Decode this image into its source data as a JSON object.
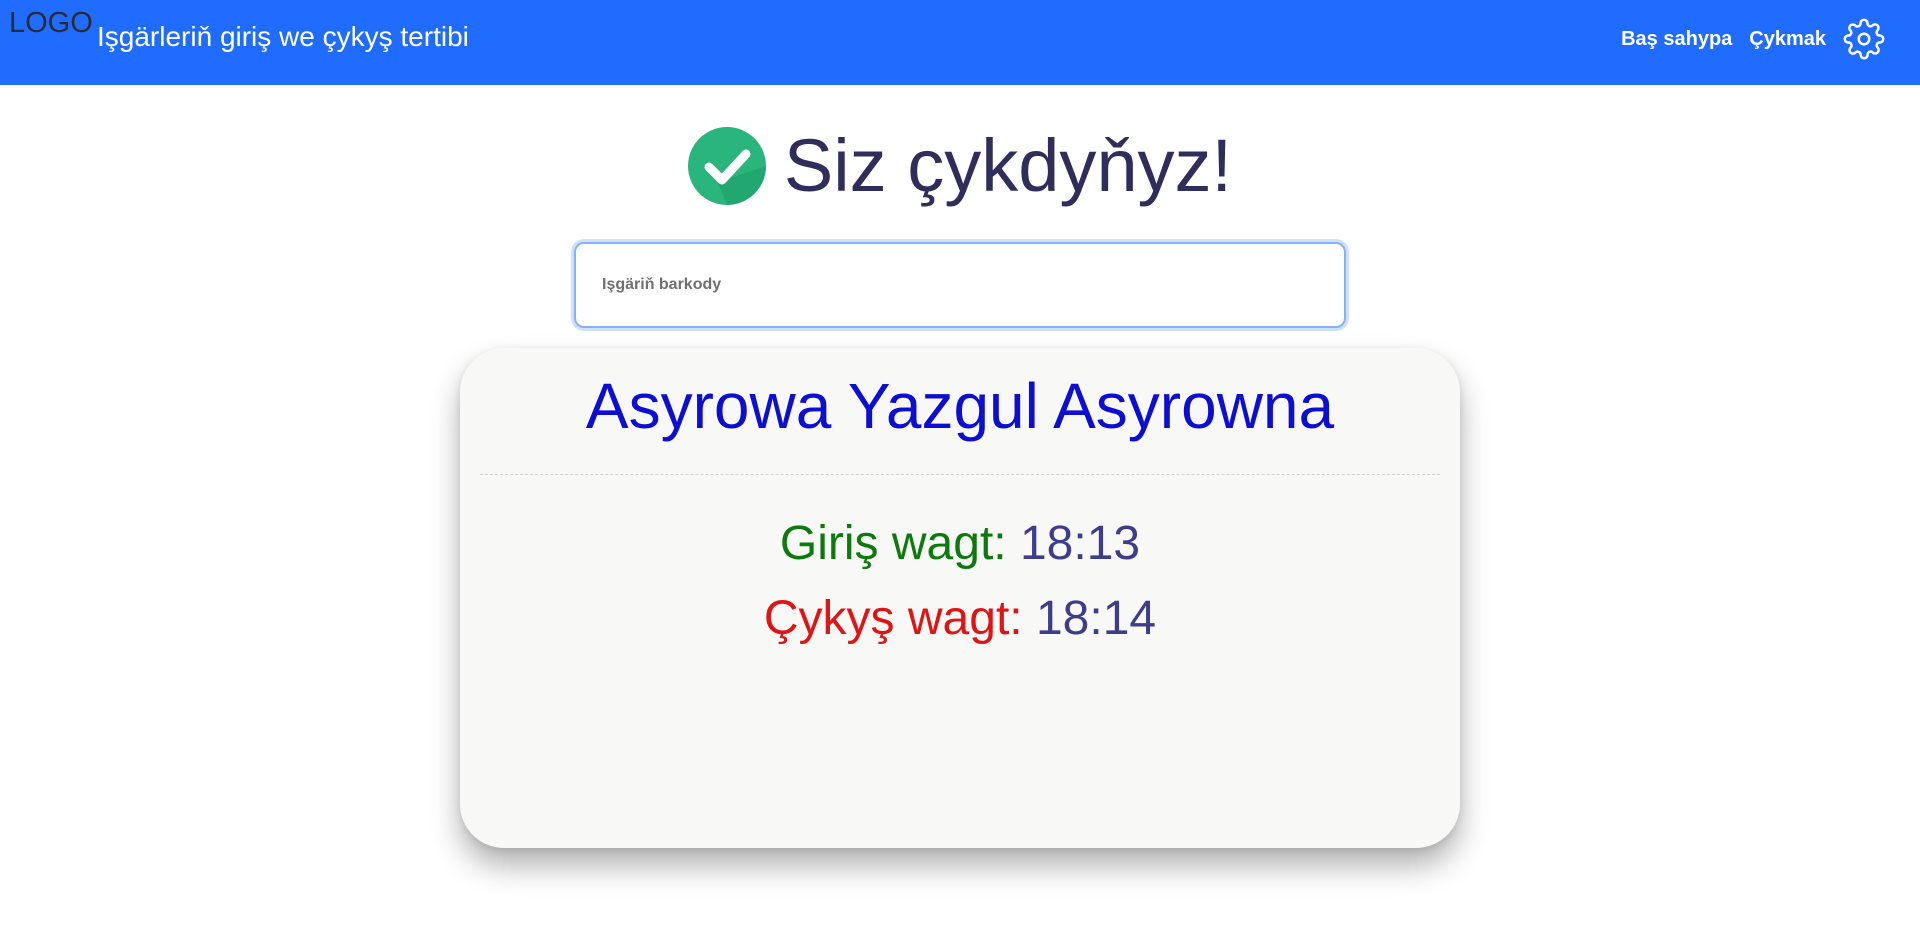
{
  "navbar": {
    "logo": "LOGO",
    "title": "Işgärleriň giriş we çykyş tertibi",
    "links": [
      "Baş sahypa",
      "Çykmak"
    ],
    "settings_icon": "gear-icon",
    "background_color": "#1f6cfe"
  },
  "status": {
    "icon": "check-circle-icon",
    "message": "Siz çykdyňyz!",
    "icon_color": "#2ab57d"
  },
  "barcode": {
    "placeholder": "Işgäriň barkody",
    "value": ""
  },
  "employee": {
    "name": "Asyrowa Yazgul Asyrowna",
    "check_in_label": "Giriş wagt:",
    "check_in_time": "18:13",
    "check_out_label": "Çykyş wagt:",
    "check_out_time": "18:14"
  },
  "colors": {
    "name": "#0c0ed3",
    "check_in_label": "#0c7a0c",
    "check_out_label": "#e01414",
    "time_value": "#3e3d8c"
  }
}
